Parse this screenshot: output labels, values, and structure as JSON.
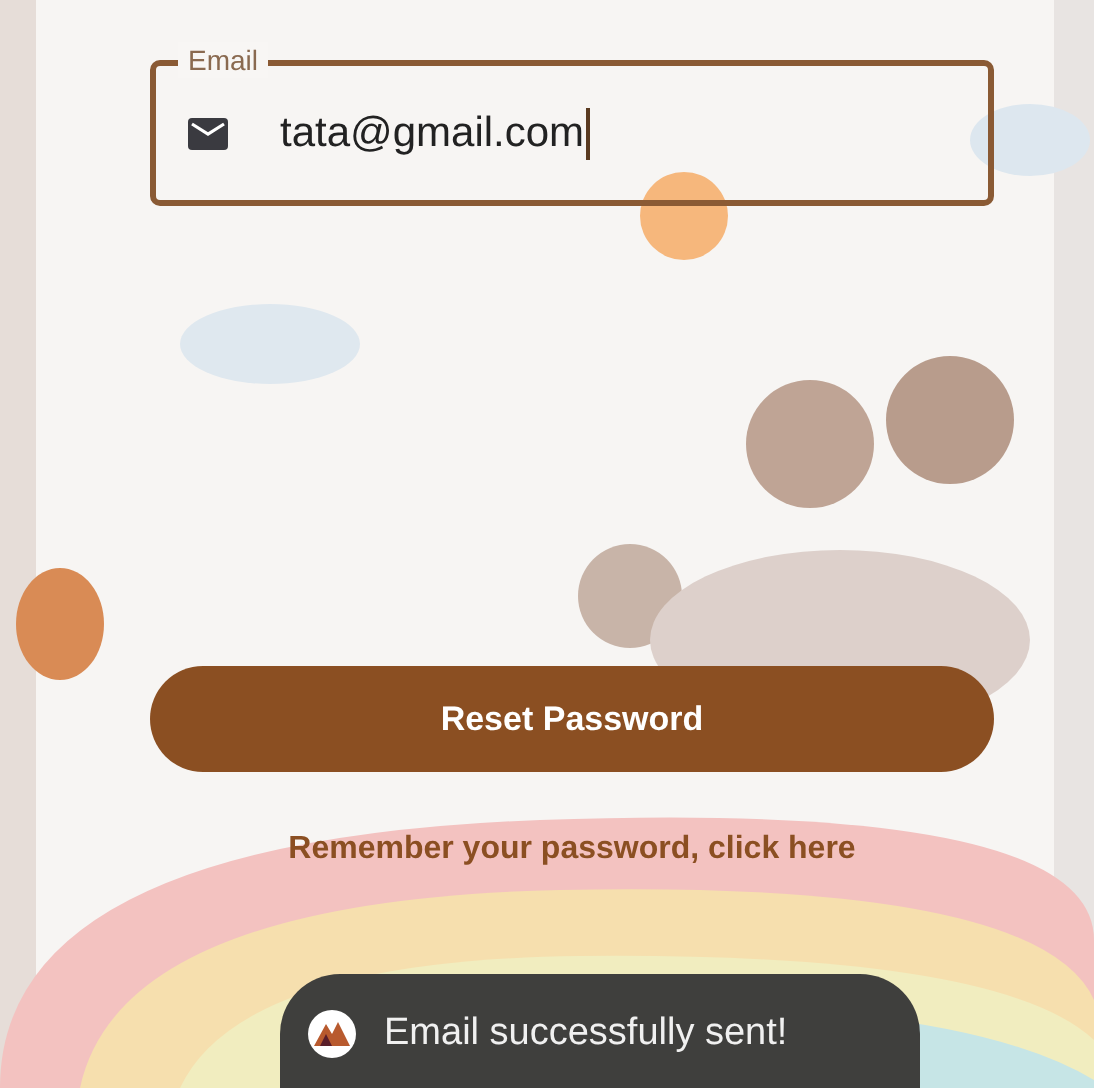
{
  "email_field": {
    "label": "Email",
    "value": "tata@gmail.com",
    "focused": true
  },
  "reset_button": {
    "label": "Reset Password"
  },
  "login_link": {
    "label": "Remember your password, click here"
  },
  "toast": {
    "message": "Email successfully sent!"
  }
}
